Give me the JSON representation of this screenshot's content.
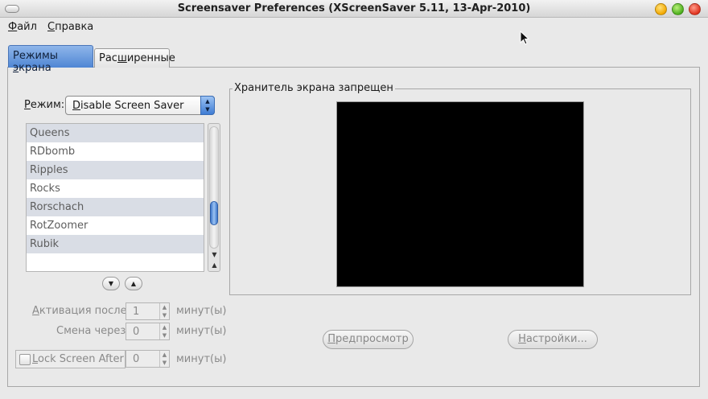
{
  "window": {
    "title": "Screensaver Preferences  (XScreenSaver 5.11, 13-Apr-2010)"
  },
  "menubar": {
    "file": {
      "accel": "Ф",
      "rest": "айл"
    },
    "help": {
      "accel": "С",
      "rest": "правка"
    }
  },
  "tabs": [
    {
      "pre": "Режимы ",
      "accel": "э",
      "post": "крана"
    },
    {
      "pre": "Рас",
      "accel": "ш",
      "post": "иренные"
    }
  ],
  "mode": {
    "label_accel": "Р",
    "label_rest": "ежим:",
    "value_accel": "D",
    "value_rest": "isable Screen Saver"
  },
  "list": {
    "items": [
      "Queens",
      "RDbomb",
      "Ripples",
      "Rocks",
      "Rorschach",
      "RotZoomer",
      "Rubik"
    ]
  },
  "activation": {
    "accel": "А",
    "rest": "ктивация после",
    "value": "1",
    "unit": "минут(ы)"
  },
  "cycle": {
    "label": "Смена через",
    "value": "0",
    "unit": "минут(ы)"
  },
  "lock": {
    "accel": "L",
    "rest": "ock Screen After",
    "value": "0",
    "unit": "минут(ы)"
  },
  "preview": {
    "frame_title": "Хранитель экрана запрещен",
    "preview_button": {
      "accel": "П",
      "rest": "редпросмотр"
    },
    "settings_button": {
      "accel": "Н",
      "rest": "астройки..."
    }
  },
  "colors": {
    "accent": "#4f86d4",
    "preview_bg": "#000000"
  }
}
